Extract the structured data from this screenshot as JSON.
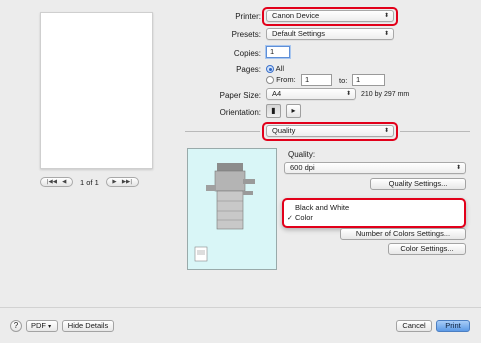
{
  "preview": {
    "page_label": "1 of 1",
    "first_icon": "|◀◀",
    "prev_icon": "◀",
    "next_icon": "▶",
    "last_icon": "▶▶|"
  },
  "printer": {
    "label": "Printer:",
    "value": "Canon Device"
  },
  "presets": {
    "label": "Presets:",
    "value": "Default Settings"
  },
  "copies": {
    "label": "Copies:",
    "value": "1"
  },
  "pages": {
    "label": "Pages:",
    "all_label": "All",
    "from_label": "From:",
    "from_value": "1",
    "to_label": "to:",
    "to_value": "1"
  },
  "paper_size": {
    "label": "Paper Size:",
    "value": "A4",
    "dimensions": "210 by 297 mm"
  },
  "orientation": {
    "label": "Orientation:"
  },
  "panel": {
    "value": "Quality"
  },
  "quality": {
    "label": "Quality:",
    "value": "600 dpi",
    "settings_button": "Quality Settings..."
  },
  "color_menu": {
    "items": [
      "Black and White",
      "Color"
    ],
    "checked_mark": "✓"
  },
  "number_of_colors_button": "Number of Colors Settings...",
  "color_settings_button": "Color Settings...",
  "footer": {
    "help": "?",
    "pdf_label": "PDF",
    "pdf_arrow": "▾",
    "hide_details": "Hide Details",
    "cancel": "Cancel",
    "print": "Print"
  },
  "colors": {
    "highlight": "#e2001a",
    "accent": "#5c9ae6",
    "preview_bg": "#d9f6f7"
  }
}
